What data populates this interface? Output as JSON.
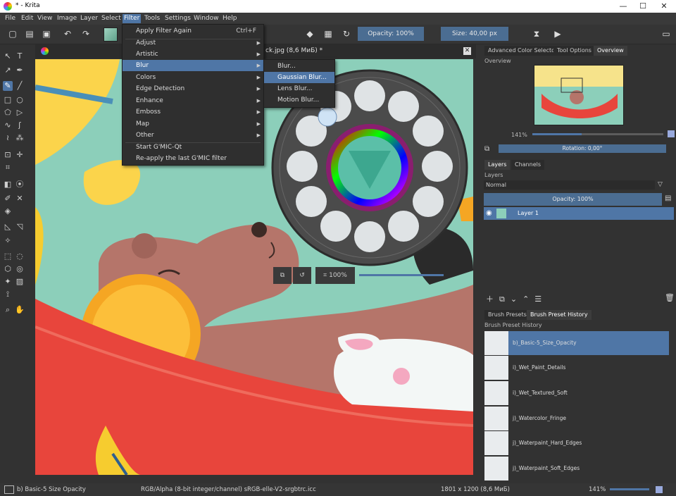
{
  "window": {
    "title": "* - Krita"
  },
  "window_controls": [
    "—",
    "☐",
    "✕"
  ],
  "menubar": [
    "File",
    "Edit",
    "View",
    "Image",
    "Layer",
    "Select",
    "Filter",
    "Tools",
    "Settings",
    "Window",
    "Help"
  ],
  "toolbar": {
    "opacity": "Opacity: 100%",
    "size": "Size: 40,00 px"
  },
  "canvas": {
    "tab_title": "ck.jpg (8,6 МиБ) *",
    "zoom": "100%"
  },
  "filter_menu": {
    "items": [
      {
        "label": "Apply Filter Again",
        "shortcut": "Ctrl+F"
      },
      {
        "label": "Adjust",
        "submenu": true
      },
      {
        "label": "Artistic",
        "submenu": true
      },
      {
        "label": "Blur",
        "submenu": true
      },
      {
        "label": "Colors",
        "submenu": true
      },
      {
        "label": "Edge Detection",
        "submenu": true
      },
      {
        "label": "Enhance",
        "submenu": true
      },
      {
        "label": "Emboss",
        "submenu": true
      },
      {
        "label": "Map",
        "submenu": true
      },
      {
        "label": "Other",
        "submenu": true
      },
      {
        "label": "Start G'MIC-Qt"
      },
      {
        "label": "Re-apply the last G'MIC filter"
      }
    ]
  },
  "blur_submenu": {
    "items": [
      "Blur...",
      "Gaussian Blur...",
      "Lens Blur...",
      "Motion Blur..."
    ]
  },
  "docker": {
    "tabs": [
      "Advanced Color Selector",
      "Tool Options",
      "Overview"
    ],
    "overview_label": "Overview",
    "zoom": "141%",
    "rotation": "Rotation: 0,00°",
    "layer_tabs": [
      "Layers",
      "Channels"
    ],
    "layers_label": "Layers",
    "blend_mode": "Normal",
    "layer_opacity": "Opacity: 100%",
    "layer_name": "Layer 1",
    "brush_tabs": [
      "Brush Presets",
      "Brush Preset History"
    ],
    "history_label": "Brush Preset History",
    "presets": [
      "b)_Basic-5_Size_Opacity",
      "i)_Wet_Paint_Details",
      "i)_Wet_Textured_Soft",
      "j)_Watercolor_Fringe",
      "j)_Waterpaint_Hard_Edges",
      "j)_Waterpaint_Soft_Edges"
    ]
  },
  "statusbar": {
    "brush": "b) Basic-5 Size Opacity",
    "colorspace": "RGB/Alpha (8-bit integer/channel)  sRGB-elle-V2-srgbtrc.icc",
    "dimensions": "1801 x 1200 (8,6 МиБ)",
    "zoom": "141%"
  },
  "colors": {
    "accent": "#4f76a6",
    "canvas_bg": "#8ccfba",
    "hammock": "#e8453c",
    "bear": "#b5756a",
    "leaf": "#fbd44b"
  }
}
